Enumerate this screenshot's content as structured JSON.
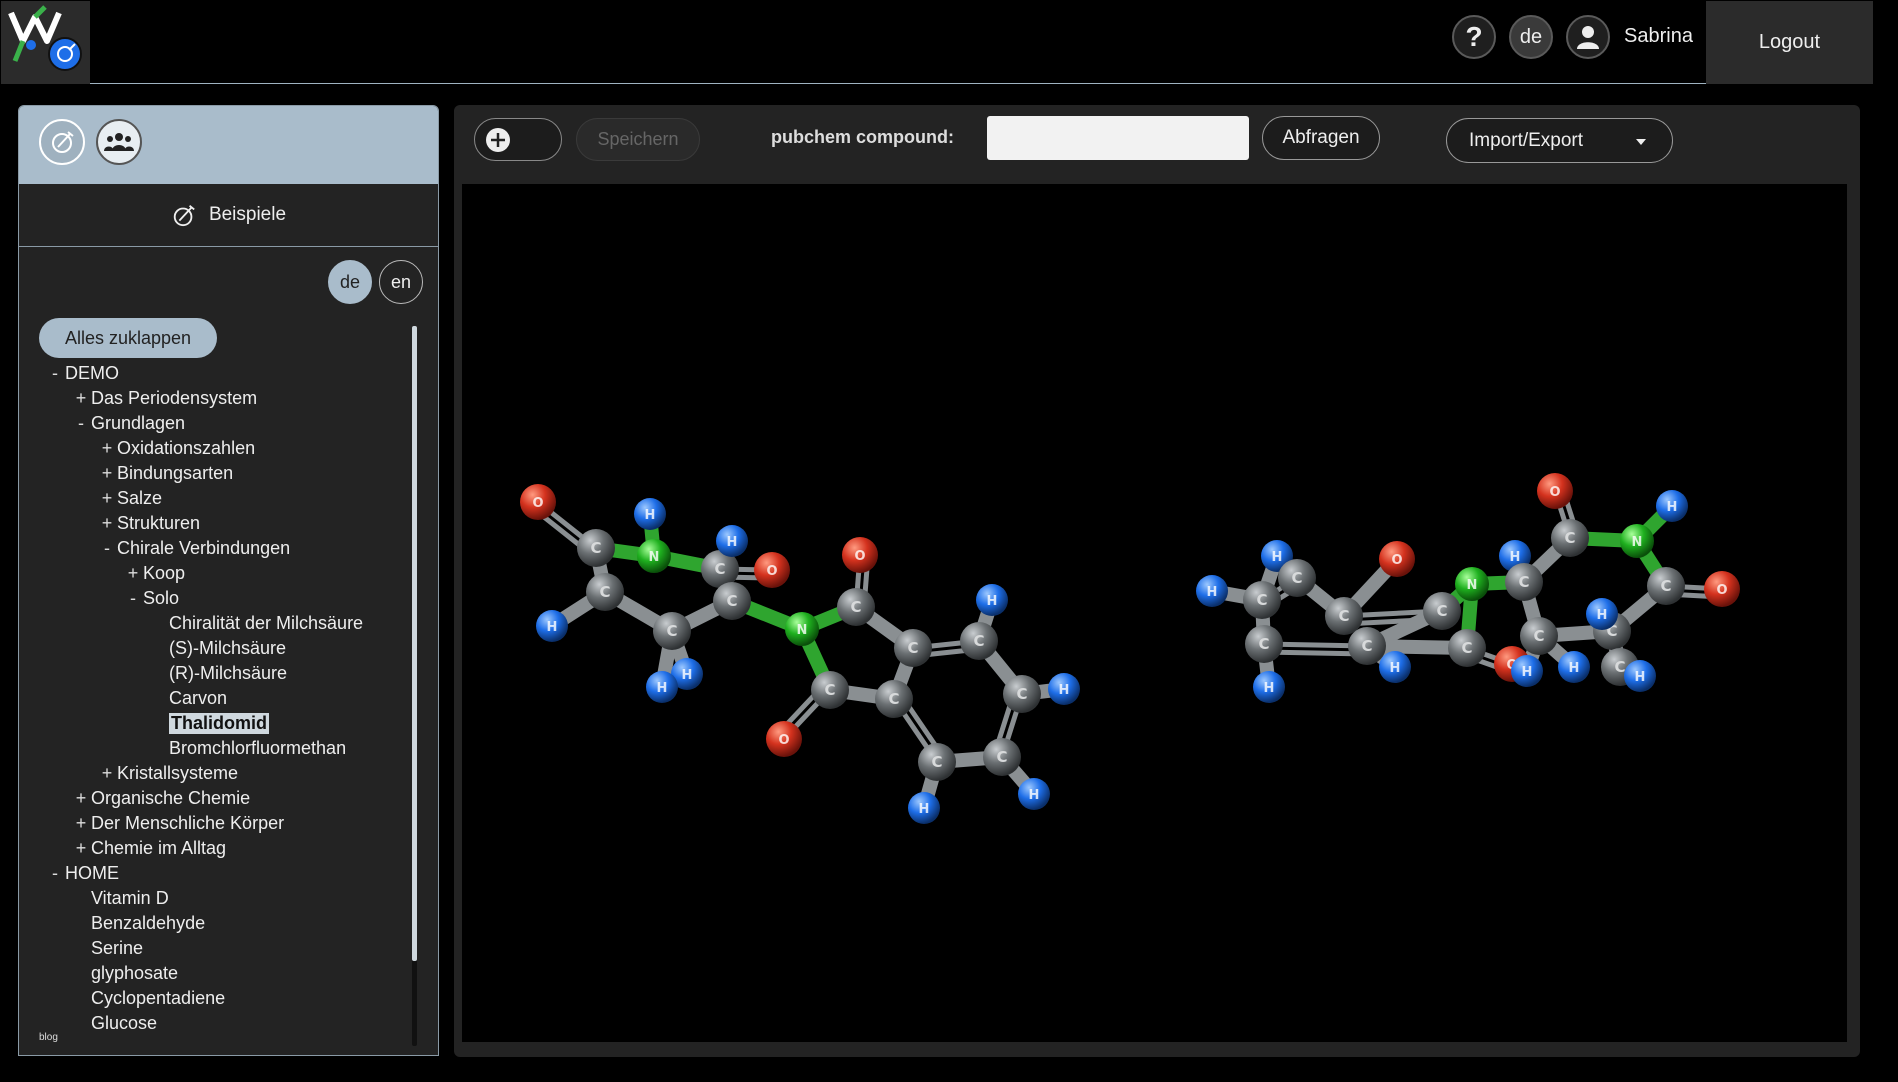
{
  "header": {
    "help_symbol": "?",
    "language": "de",
    "username": "Sabrina",
    "logout_label": "Logout"
  },
  "sidebar": {
    "title": "Beispiele",
    "languages": [
      "de",
      "en"
    ],
    "collapse_all_label": "Alles zuklappen",
    "tree": [
      {
        "label": "DEMO",
        "toggle": "-",
        "level": 0
      },
      {
        "label": "Das Periodensystem",
        "toggle": "+",
        "level": 1
      },
      {
        "label": "Grundlagen",
        "toggle": "-",
        "level": 1
      },
      {
        "label": "Oxidationszahlen",
        "toggle": "+",
        "level": 2
      },
      {
        "label": "Bindungsarten",
        "toggle": "+",
        "level": 2
      },
      {
        "label": "Salze",
        "toggle": "+",
        "level": 2
      },
      {
        "label": "Strukturen",
        "toggle": "+",
        "level": 2
      },
      {
        "label": "Chirale Verbindungen",
        "toggle": "-",
        "level": 2
      },
      {
        "label": "Koop",
        "toggle": "+",
        "level": 3
      },
      {
        "label": "Solo",
        "toggle": "-",
        "level": 3
      },
      {
        "label": "Chiralität der Milchsäure",
        "toggle": "",
        "level": 4
      },
      {
        "label": "(S)-Milchsäure",
        "toggle": "",
        "level": 4
      },
      {
        "label": "(R)-Milchsäure",
        "toggle": "",
        "level": 4
      },
      {
        "label": "Carvon",
        "toggle": "",
        "level": 4
      },
      {
        "label": "Thalidomid",
        "toggle": "",
        "level": 4,
        "selected": true
      },
      {
        "label": "Bromchlorfluormethan",
        "toggle": "",
        "level": 4
      },
      {
        "label": "Kristallsysteme",
        "toggle": "+",
        "level": 2
      },
      {
        "label": "Organische Chemie",
        "toggle": "+",
        "level": 1
      },
      {
        "label": "Der Menschliche Körper",
        "toggle": "+",
        "level": 1
      },
      {
        "label": "Chemie im Alltag",
        "toggle": "+",
        "level": 1
      },
      {
        "label": "HOME",
        "toggle": "-",
        "level": 0
      },
      {
        "label": "Vitamin D",
        "toggle": "",
        "level": 1
      },
      {
        "label": "Benzaldehyde",
        "toggle": "",
        "level": 1
      },
      {
        "label": "Serine",
        "toggle": "",
        "level": 1
      },
      {
        "label": "glyphosate",
        "toggle": "",
        "level": 1
      },
      {
        "label": "Cyclopentadiene",
        "toggle": "",
        "level": 1
      },
      {
        "label": "Glucose",
        "toggle": "",
        "level": 1
      }
    ],
    "footer_link": "blog"
  },
  "toolbar": {
    "save_label": "Speichern",
    "pubchem_label": "pubchem compound:",
    "pubchem_value": "",
    "query_label": "Abfragen",
    "import_export_label": "Import/Export"
  },
  "colors": {
    "carbon": "#6b7073",
    "oxygen": "#d4321e",
    "nitrogen": "#1fb01f",
    "hydrogen": "#1e6ee8",
    "panel_header": "#a9bccb"
  }
}
